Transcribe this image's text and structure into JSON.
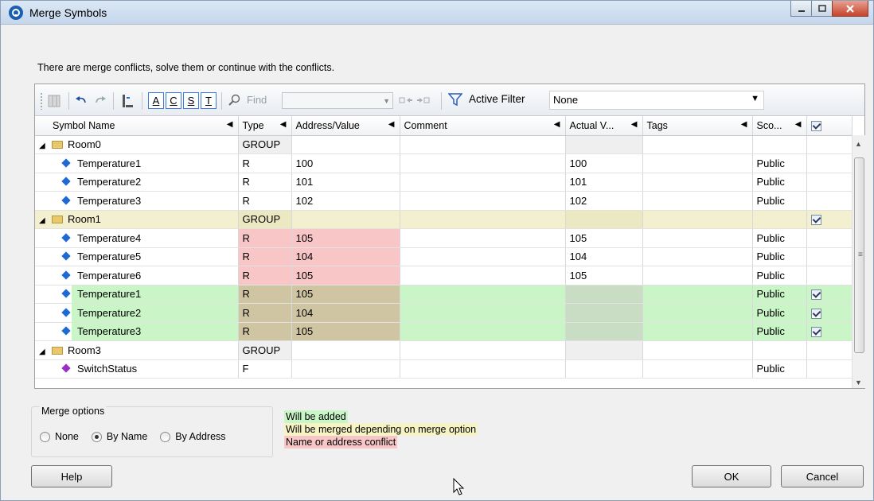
{
  "window": {
    "title": "Merge Symbols"
  },
  "message": "There are merge conflicts, solve them or continue with the conflicts.",
  "toolbar": {
    "letter_buttons": [
      "A",
      "C",
      "S",
      "T"
    ],
    "find_label": "Find",
    "active_filter_label": "Active Filter",
    "filter_value": "None"
  },
  "columns": [
    "Symbol Name",
    "Type",
    "Address/Value",
    "Comment",
    "Actual V...",
    "Tags",
    "Sco..."
  ],
  "rows": [
    {
      "name": "Room0",
      "type": "GROUP",
      "addr": "",
      "comment": "",
      "actual": "",
      "tags": "",
      "scope": ""
    },
    {
      "name": "Temperature1",
      "type": "R",
      "addr": "100",
      "comment": "",
      "actual": "100",
      "tags": "",
      "scope": "Public"
    },
    {
      "name": "Temperature2",
      "type": "R",
      "addr": "101",
      "comment": "",
      "actual": "101",
      "tags": "",
      "scope": "Public"
    },
    {
      "name": "Temperature3",
      "type": "R",
      "addr": "102",
      "comment": "",
      "actual": "102",
      "tags": "",
      "scope": "Public"
    },
    {
      "name": "Room1",
      "type": "GROUP",
      "addr": "",
      "comment": "",
      "actual": "",
      "tags": "",
      "scope": ""
    },
    {
      "name": "Temperature4",
      "type": "R",
      "addr": "105",
      "comment": "",
      "actual": "105",
      "tags": "",
      "scope": "Public"
    },
    {
      "name": "Temperature5",
      "type": "R",
      "addr": "104",
      "comment": "",
      "actual": "104",
      "tags": "",
      "scope": "Public"
    },
    {
      "name": "Temperature6",
      "type": "R",
      "addr": "105",
      "comment": "",
      "actual": "105",
      "tags": "",
      "scope": "Public"
    },
    {
      "name": "Temperature1",
      "type": "R",
      "addr": "105",
      "comment": "",
      "actual": "",
      "tags": "",
      "scope": "Public"
    },
    {
      "name": "Temperature2",
      "type": "R",
      "addr": "104",
      "comment": "",
      "actual": "",
      "tags": "",
      "scope": "Public"
    },
    {
      "name": "Temperature3",
      "type": "R",
      "addr": "105",
      "comment": "",
      "actual": "",
      "tags": "",
      "scope": "Public"
    },
    {
      "name": "Room3",
      "type": "GROUP",
      "addr": "",
      "comment": "",
      "actual": "",
      "tags": "",
      "scope": ""
    },
    {
      "name": "SwitchStatus",
      "type": "F",
      "addr": "",
      "comment": "",
      "actual": "",
      "tags": "",
      "scope": "Public"
    }
  ],
  "merge_options": {
    "title": "Merge options",
    "options": [
      "None",
      "By Name",
      "By Address"
    ],
    "selected": "By Name"
  },
  "legend": {
    "added": "Will be added",
    "merged": "Will be merged depending on merge option",
    "conflict": "Name or address conflict"
  },
  "buttons": {
    "help": "Help",
    "ok": "OK",
    "cancel": "Cancel"
  },
  "colors": {
    "added": "#c9f5c7",
    "merged": "#f6f3c4",
    "conflict": "#f8c6c6",
    "conflict_added": "#cfc5a3",
    "accent": "#1e6ad4"
  }
}
